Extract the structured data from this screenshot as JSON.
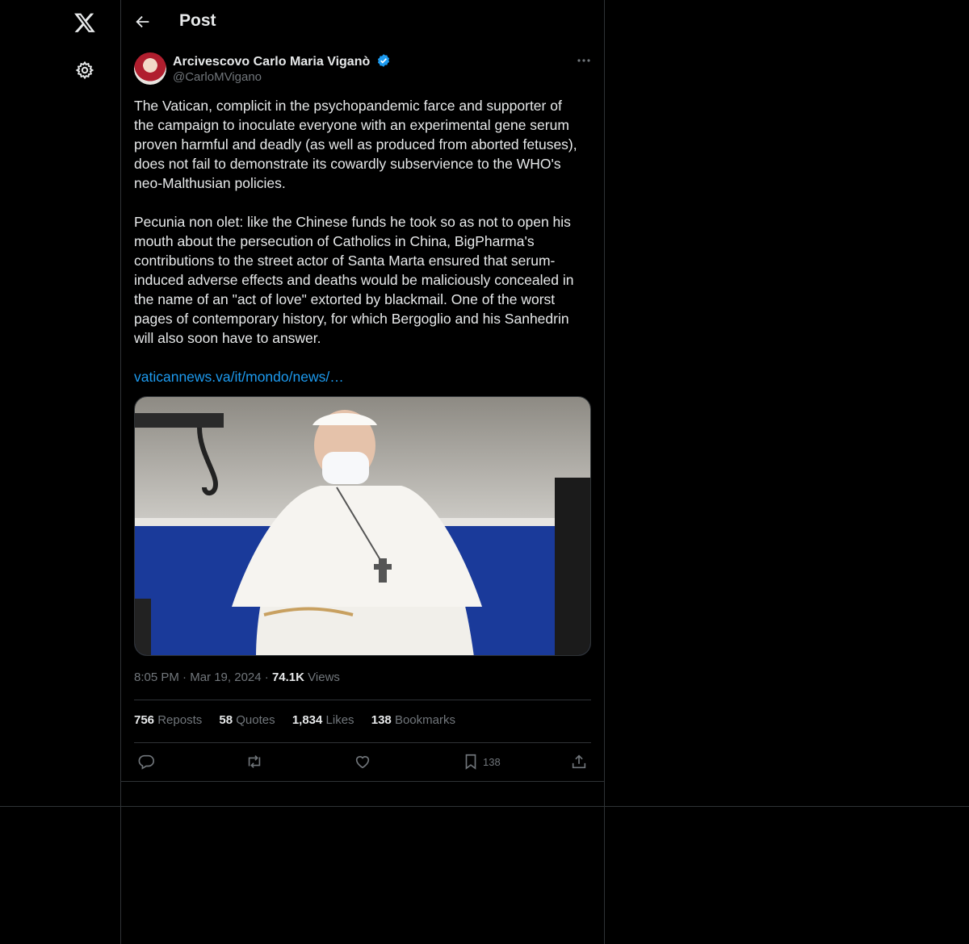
{
  "header": {
    "title": "Post"
  },
  "icons": {
    "logo": "x-logo-icon",
    "settings": "gear-icon",
    "back": "arrow-left-icon",
    "more": "more-horizontal-icon",
    "verified": "verified-badge-icon"
  },
  "post": {
    "author_name": "Arcivescovo Carlo Maria Viganò",
    "author_handle": "@CarloMVigano",
    "text": "The Vatican, complicit in the psychopandemic farce and supporter of\nthe campaign to inoculate everyone with an experimental gene serum\nproven harmful and deadly (as well as produced from aborted fetuses),\ndoes not fail to demonstrate its cowardly subservience to the WHO's\nneo-Malthusian policies.\n\nPecunia non olet: like the Chinese funds he took so as not to open his\nmouth about the persecution of Catholics in China, BigPharma's\ncontributions to the street actor of Santa Marta ensured that serum-\ninduced adverse effects and deaths would be maliciously concealed in\nthe name of an \"act of love\" extorted by blackmail. One of the worst\npages of contemporary history, for which Bergoglio and his Sanhedrin\nwill also soon have to answer.",
    "link": "vaticannews.va/it/mondo/news/…",
    "time": "8:05 PM",
    "date": "Mar 19, 2024",
    "views_count": "74.1K",
    "views_label": "Views",
    "stats": {
      "reposts": "756",
      "reposts_label": "Reposts",
      "quotes": "58",
      "quotes_label": "Quotes",
      "likes": "1,834",
      "likes_label": "Likes",
      "bookmarks": "138",
      "bookmarks_label": "Bookmarks"
    },
    "action_bookmark_count": "138"
  },
  "colors": {
    "background": "#000000",
    "text": "#e7e9ea",
    "muted": "#71767b",
    "link": "#1d9bf0",
    "border": "#2f3336"
  }
}
